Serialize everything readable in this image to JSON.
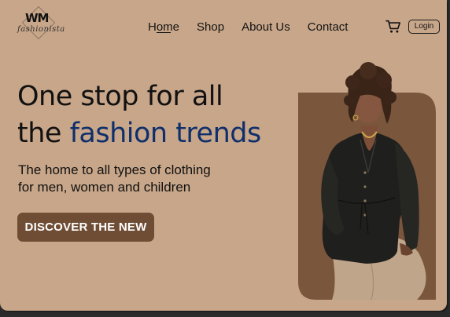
{
  "logo": {
    "mark": "WM",
    "script": "fashionista"
  },
  "nav": {
    "items": [
      {
        "label": "Home",
        "active": true
      },
      {
        "label": "Shop",
        "active": false
      },
      {
        "label": "About Us",
        "active": false
      },
      {
        "label": "Contact",
        "active": false
      }
    ]
  },
  "header": {
    "cart_icon": "shopping-cart-icon",
    "login_label": "Login"
  },
  "hero": {
    "title_line1": "One stop for all",
    "title_line2_prefix": "the ",
    "title_line2_accent": "fashion trends",
    "subtitle_line1": "The home to all types of clothing",
    "subtitle_line2": "for men, women and children",
    "cta_label": "DISCOVER THE NEW",
    "image_alt": "Model in black blazer and beige trousers"
  },
  "colors": {
    "background": "#c8a689",
    "accent_blue": "#0f2f6b",
    "cta_brown": "#6f4d35",
    "image_panel": "#7a563d"
  }
}
